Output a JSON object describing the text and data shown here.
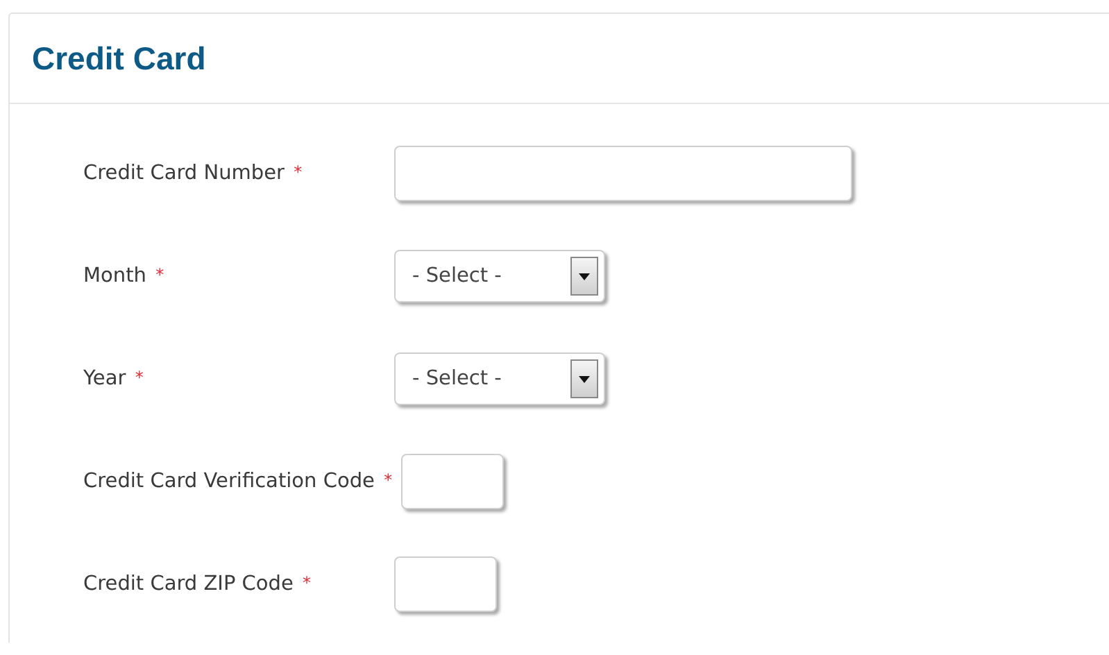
{
  "panel": {
    "title": "Credit Card"
  },
  "fields": [
    {
      "kind": "wideinput",
      "label": "Credit Card Number",
      "required_mark": "*"
    },
    {
      "kind": "select",
      "label": "Month",
      "required_mark": "*",
      "value": "- Select -"
    },
    {
      "kind": "select",
      "label": "Year",
      "required_mark": "*",
      "value": "- Select -"
    },
    {
      "kind": "shortinput",
      "label": "Credit Card Verification Code",
      "required_mark": "*"
    },
    {
      "kind": "shortinput",
      "label": "Credit Card ZIP Code",
      "required_mark": "*"
    }
  ]
}
